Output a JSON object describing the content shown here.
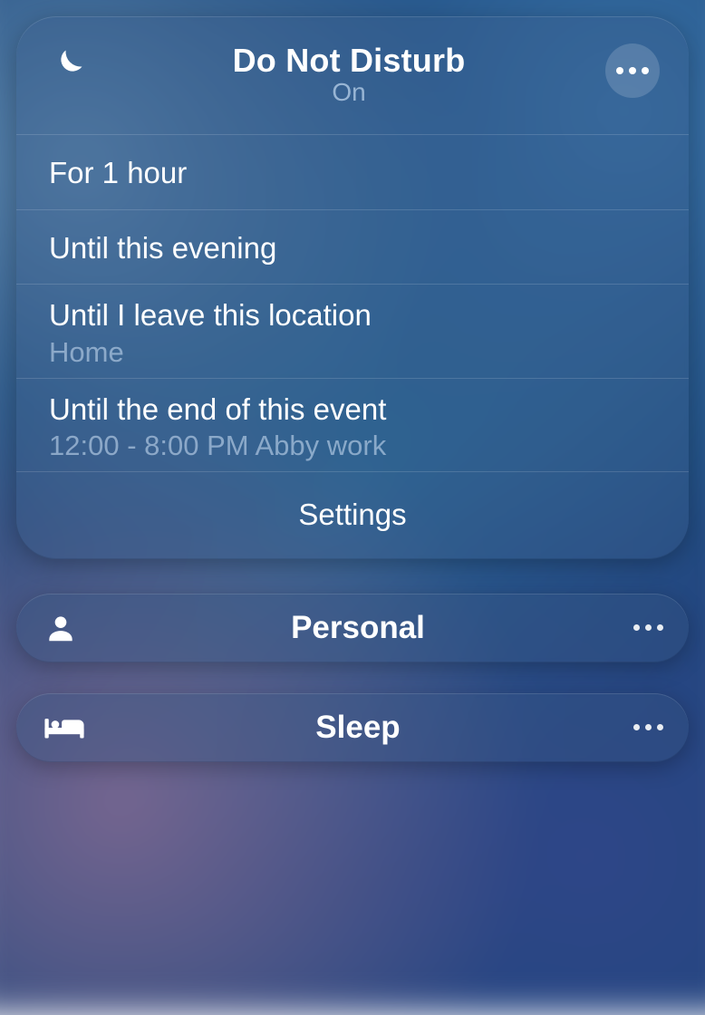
{
  "dnd": {
    "title": "Do Not Disturb",
    "status": "On",
    "options": [
      {
        "primary": "For 1 hour",
        "secondary": ""
      },
      {
        "primary": "Until this evening",
        "secondary": ""
      },
      {
        "primary": "Until I leave this location",
        "secondary": "Home"
      },
      {
        "primary": "Until the end of this event",
        "secondary": "12:00 - 8:00 PM Abby work"
      }
    ],
    "settings_label": "Settings"
  },
  "focus_modes": [
    {
      "label": "Personal",
      "icon": "person"
    },
    {
      "label": "Sleep",
      "icon": "bed"
    }
  ]
}
